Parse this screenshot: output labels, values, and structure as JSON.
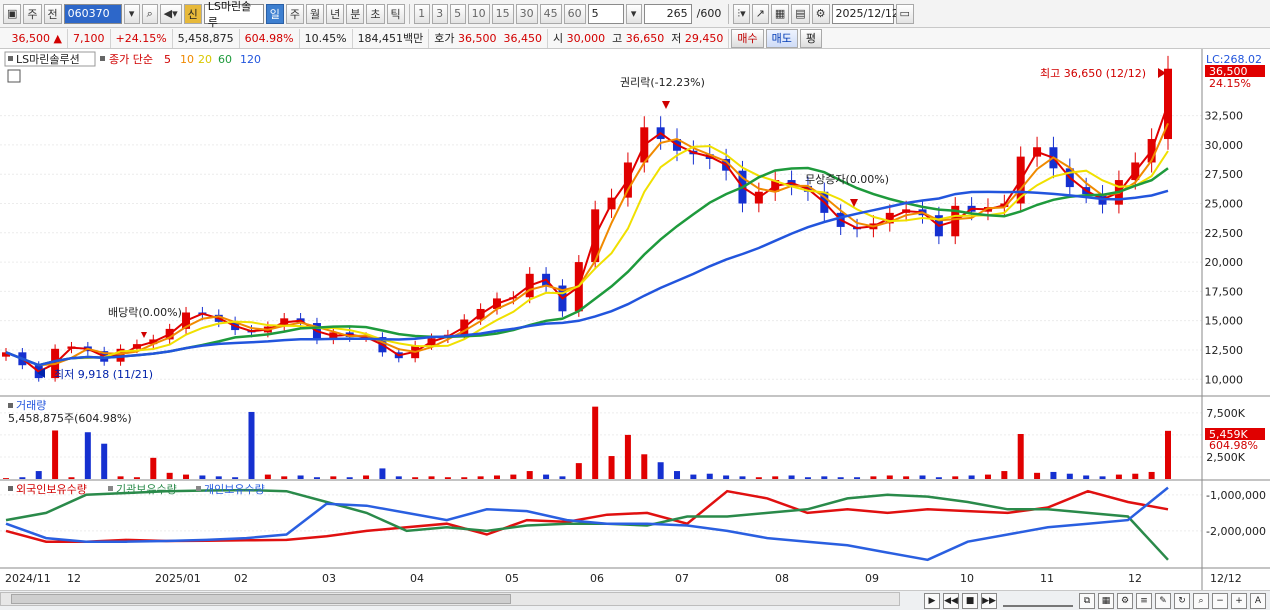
{
  "toolbar": {
    "period_main": "주",
    "prev_label": "전",
    "code": "060370",
    "stock_badge": "신",
    "stock_name": "LS마린솔루",
    "periods": [
      "일",
      "주",
      "월",
      "년",
      "분",
      "초",
      "틱"
    ],
    "active_period": "일",
    "intervals": [
      "1",
      "3",
      "5",
      "10",
      "15",
      "30",
      "45",
      "60"
    ],
    "interval_select": "5",
    "count": "265",
    "count_total": "/600",
    "date": "2025/12/12"
  },
  "infobar": {
    "price": "36,500",
    "change": "7,100",
    "change_pct": "+24.15%",
    "volume": "5,458,875",
    "vol_ratio": "604.98%",
    "turnover": "10.45%",
    "amount": "184,451백만",
    "bid_label": "호가",
    "ask": "36,500",
    "bid": "36,450",
    "open_label": "시",
    "open": "30,000",
    "high_label": "고",
    "high": "36,650",
    "low_label": "저",
    "low": "29,450",
    "buy_btn": "매수",
    "sell_btn": "매도",
    "eval_btn": "평"
  },
  "price_panel": {
    "stock_label": "LS마린솔루션",
    "legend_prefix": "종가 단순",
    "ma_labels": [
      "5",
      "10",
      "20",
      "60",
      "120"
    ],
    "lc_label": "LC:268.02",
    "price_tag": "36,500",
    "pct_tag": "24.15%",
    "annotations": {
      "high": "최고 36,650 (12/12)",
      "low": "최저 9,918 (11/21)",
      "dividend": "배당락(0.00%)",
      "rights": "권리락(-12.23%)",
      "bonus": "무상증자(0.00%)"
    }
  },
  "volume_panel": {
    "title": "거래량",
    "subtitle": "5,458,875주(604.98%)",
    "tag_value": "5,459K",
    "tag_pct": "604.98%"
  },
  "holdings_panel": {
    "legend": [
      "외국인보유수량",
      "기관보유수량",
      "개인보유수량"
    ]
  },
  "x_axis": [
    "2024/11",
    "12",
    "2025/01",
    "02",
    "03",
    "04",
    "05",
    "06",
    "07",
    "08",
    "09",
    "10",
    "11",
    "12"
  ],
  "x_axis_right": "12/12",
  "colors": {
    "up": "#e00000",
    "down": "#1530d0",
    "ma5": "#e00000",
    "ma10": "#f08a00",
    "ma20": "#f0e000",
    "ma60": "#1e9a3c",
    "ma120": "#2255dd",
    "foreign": "#e01010",
    "inst": "#2a8a4a",
    "indiv": "#2a5fe0"
  },
  "chart_data": [
    {
      "type": "line",
      "title": "LS마린솔루션",
      "series": [
        {
          "name": "종가",
          "values": [
            12300,
            11200,
            10100,
            12600,
            12800,
            12400,
            11500,
            12600,
            13000,
            13400,
            14300,
            15700,
            15500,
            14900,
            14200,
            14000,
            14500,
            15200,
            14800,
            13400,
            14000,
            13600,
            13600,
            12300,
            11800,
            12900,
            13500,
            13800,
            15100,
            16000,
            16900,
            17000,
            19000,
            18000,
            15800,
            20000,
            24500,
            25500,
            28500,
            31500,
            30500,
            29500,
            29200,
            28800,
            27800,
            25000,
            26000,
            27000,
            26500,
            26000,
            24200,
            23000,
            22800,
            23300,
            24200,
            24500,
            24000,
            22200,
            24800,
            24300,
            24700,
            25000,
            29000,
            29800,
            28000,
            26400,
            25800,
            24900,
            27000,
            28500,
            30500,
            36500
          ]
        }
      ],
      "ylim": [
        9000,
        37500
      ],
      "yticks": [
        10000,
        12500,
        15000,
        17500,
        20000,
        22500,
        25000,
        27500,
        30000,
        32500
      ]
    },
    {
      "type": "bar",
      "title": "거래량",
      "values": [
        100,
        200,
        900,
        5500,
        200,
        5300,
        4000,
        300,
        200,
        2400,
        700,
        500,
        400,
        300,
        200,
        7600,
        500,
        300,
        400,
        200,
        300,
        200,
        400,
        1200,
        300,
        200,
        300,
        200,
        200,
        300,
        400,
        500,
        900,
        500,
        300,
        1800,
        8200,
        2600,
        5000,
        2800,
        1900,
        900,
        500,
        600,
        400,
        300,
        200,
        300,
        400,
        200,
        300,
        200,
        200,
        300,
        400,
        300,
        400,
        200,
        300,
        400,
        500,
        900,
        5100,
        700,
        800,
        600,
        400,
        300,
        500,
        600,
        800,
        5459
      ],
      "ylim": [
        0,
        8500
      ],
      "yticks": [
        2500,
        5000,
        7500
      ]
    },
    {
      "type": "line",
      "title": "보유수량",
      "series": [
        {
          "name": "외국인보유수량",
          "values": [
            -2000000,
            -2300000,
            -2300000,
            -2250000,
            -2280000,
            -2270000,
            -2260000,
            -2250000,
            -2150000,
            -2000000,
            -1900000,
            -1800000,
            -2100000,
            -1700000,
            -1750000,
            -1550000,
            -1500000,
            -1800000,
            -900000,
            -1100000,
            -1500000,
            -1400000,
            -1500000,
            -1400000,
            -1450000,
            -1500000,
            -1350000,
            -900000,
            -1200000,
            -1400000
          ]
        },
        {
          "name": "기관보유수량",
          "values": [
            -1700000,
            -1500000,
            -1000000,
            -950000,
            -900000,
            -880000,
            -870000,
            -900000,
            -1200000,
            -1500000,
            -2000000,
            -1900000,
            -2000000,
            -1850000,
            -1800000,
            -1800000,
            -1850000,
            -1600000,
            -1600000,
            -1500000,
            -1400000,
            -1100000,
            -1000000,
            -1050000,
            -1200000,
            -1400000,
            -1400000,
            -1500000,
            -1600000,
            -2800000
          ]
        },
        {
          "name": "개인보유수량",
          "values": [
            -1800000,
            -2200000,
            -2300000,
            -2300000,
            -2280000,
            -2250000,
            -2200000,
            -2100000,
            -1250000,
            -1300000,
            -1500000,
            -1700000,
            -1400000,
            -1450000,
            -1700000,
            -1800000,
            -1800000,
            -1850000,
            -2000000,
            -2200000,
            -2300000,
            -2400000,
            -2600000,
            -2800000,
            -2300000,
            -2100000,
            -1900000,
            -1800000,
            -1700000,
            -800000
          ]
        }
      ],
      "ylim": [
        -3000000,
        -700000
      ],
      "yticks": [
        -1000000,
        -2000000
      ]
    }
  ]
}
